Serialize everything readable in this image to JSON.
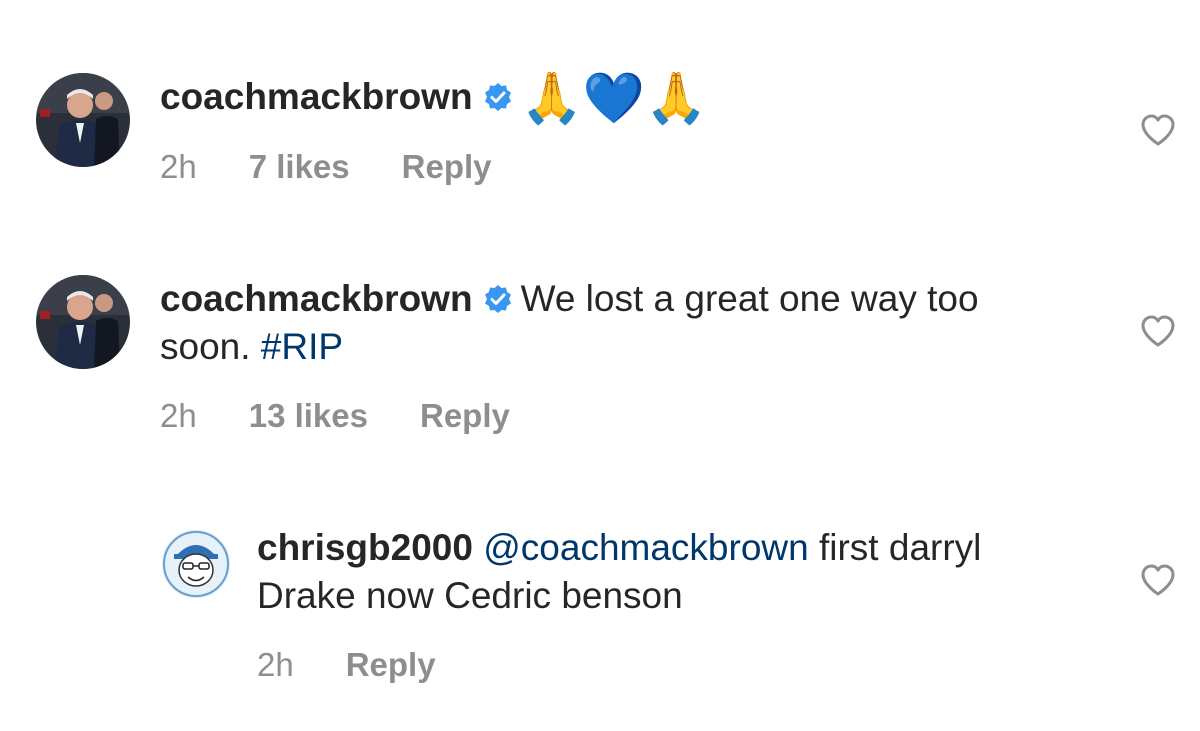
{
  "comments": [
    {
      "username": "coachmackbrown",
      "verified": true,
      "text": "🙏💙🙏",
      "time": "2h",
      "likes": "7 likes",
      "reply_label": "Reply"
    },
    {
      "username": "coachmackbrown",
      "verified": true,
      "text": "We lost a great one way too soon.",
      "hashtag": "#RIP",
      "time": "2h",
      "likes": "13 likes",
      "reply_label": "Reply"
    },
    {
      "username": "chrisgb2000",
      "verified": false,
      "mention": "@coachmackbrown",
      "text": "first darryl Drake now Cedric benson",
      "time": "2h",
      "reply_label": "Reply"
    }
  ],
  "colors": {
    "text": "#262626",
    "meta": "#8e8e8e",
    "link": "#00376b",
    "verified": "#3897f0"
  },
  "icons": [
    "verified-badge-icon",
    "heart-icon"
  ]
}
